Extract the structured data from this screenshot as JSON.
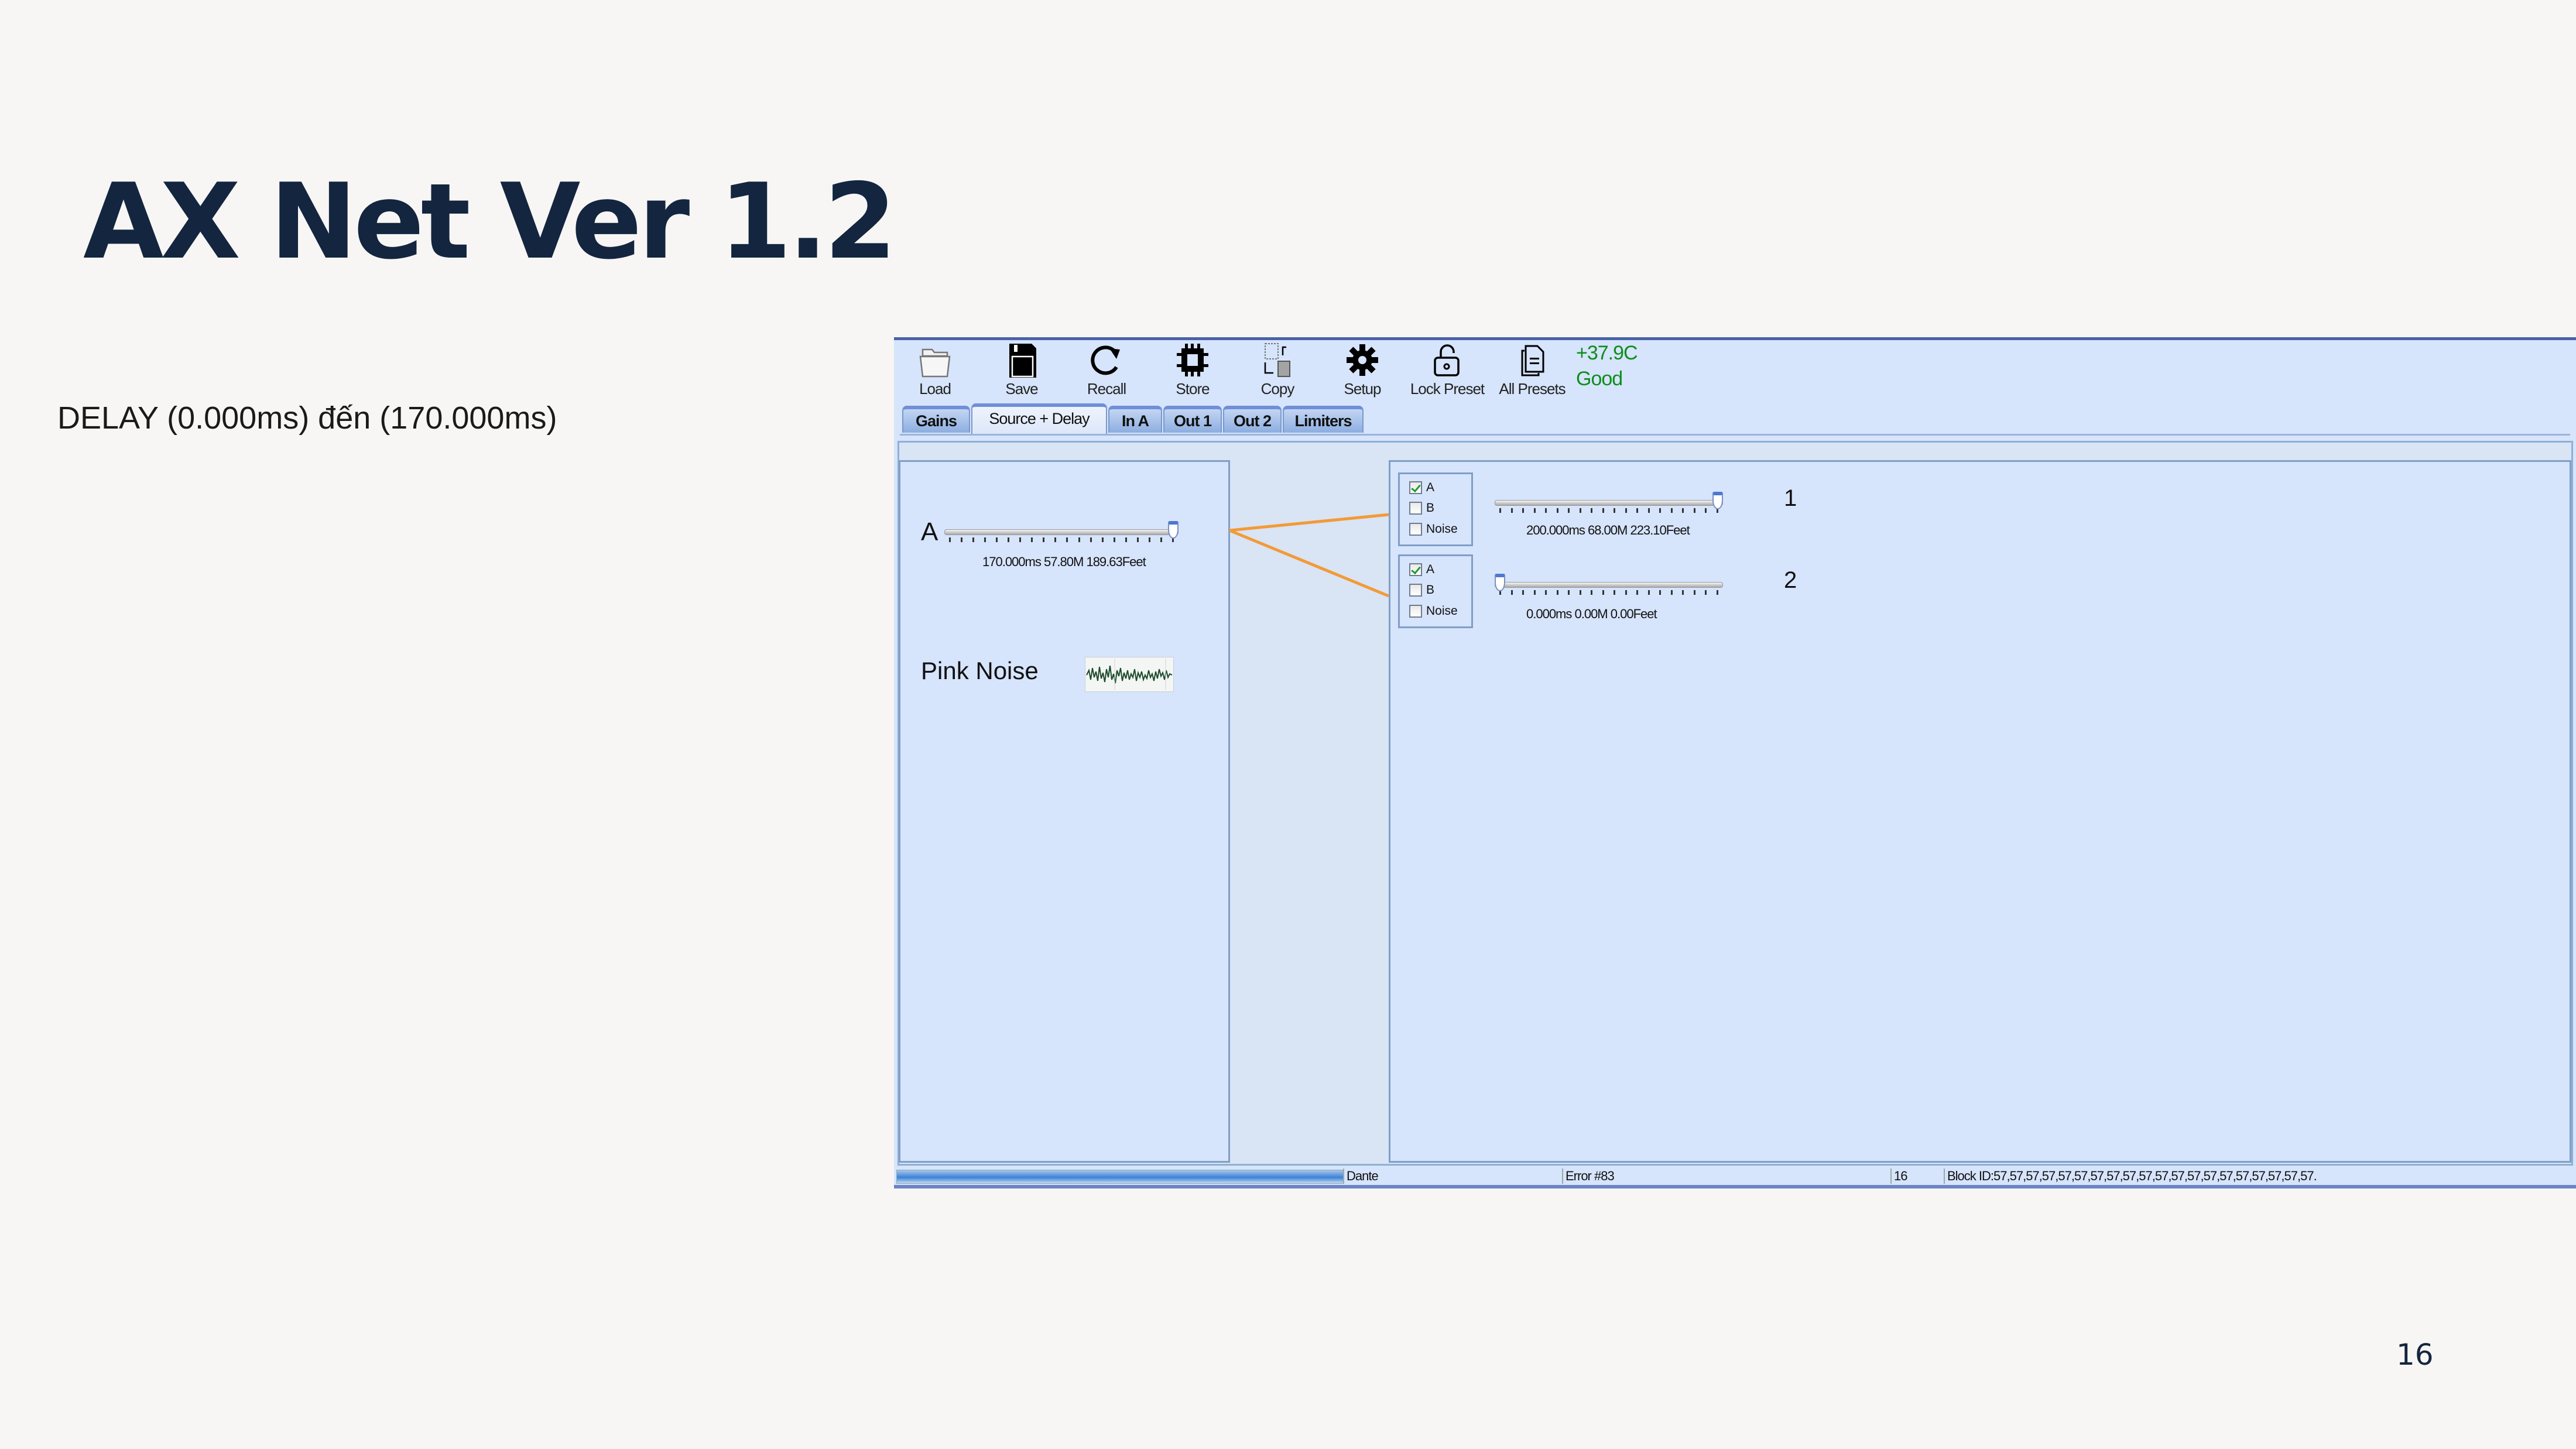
{
  "slide": {
    "title": "AX Net Ver 1.2",
    "description": "DELAY (0.000ms) đến (170.000ms)",
    "page_number": "16"
  },
  "toolbar": {
    "items": [
      {
        "label": "Load",
        "icon": "folder-icon"
      },
      {
        "label": "Save",
        "icon": "floppy-disk-icon"
      },
      {
        "label": "Recall",
        "icon": "refresh-icon"
      },
      {
        "label": "Store",
        "icon": "chip-icon"
      },
      {
        "label": "Copy",
        "icon": "copy-icon"
      },
      {
        "label": "Setup",
        "icon": "gear-icon"
      },
      {
        "label": "Lock Preset",
        "icon": "unlock-icon"
      },
      {
        "label": "All Presets",
        "icon": "documents-icon"
      }
    ],
    "temperature": "+37.9C",
    "status": "Good",
    "status_color": "#0f8d1c"
  },
  "tabs": [
    {
      "label": "Gains",
      "active": false
    },
    {
      "label": "Source + Delay",
      "active": true
    },
    {
      "label": "In A",
      "active": false
    },
    {
      "label": "Out 1",
      "active": false
    },
    {
      "label": "Out 2",
      "active": false
    },
    {
      "label": "Limiters",
      "active": false
    }
  ],
  "inputs": {
    "channel_a": {
      "label": "A",
      "delay_fraction": 1.0,
      "readout": "170.000ms 57.80M 189.63Feet"
    },
    "pink_noise": {
      "label": "Pink Noise"
    }
  },
  "outputs": [
    {
      "number": "1",
      "sources": [
        {
          "label": "A",
          "checked": true
        },
        {
          "label": "B",
          "checked": false
        },
        {
          "label": "Noise",
          "checked": false
        }
      ],
      "delay_fraction": 1.0,
      "readout": "200.000ms 68.00M 223.10Feet"
    },
    {
      "number": "2",
      "sources": [
        {
          "label": "A",
          "checked": true
        },
        {
          "label": "B",
          "checked": false
        },
        {
          "label": "Noise",
          "checked": false
        }
      ],
      "delay_fraction": 0.0,
      "readout": "0.000ms 0.00M 0.00Feet"
    }
  ],
  "routing": {
    "color": "#f39a36",
    "links": [
      {
        "from": "A",
        "to": "1"
      },
      {
        "from": "A",
        "to": "2"
      }
    ]
  },
  "statusbar": {
    "progress_fraction": 1.0,
    "network": "Dante",
    "error": "Error #83",
    "count": "16",
    "block_id": "Block ID:57,57,57,57,57,57,57,57,57,57,57,57,57,57,57,57,57,57,57,57."
  }
}
